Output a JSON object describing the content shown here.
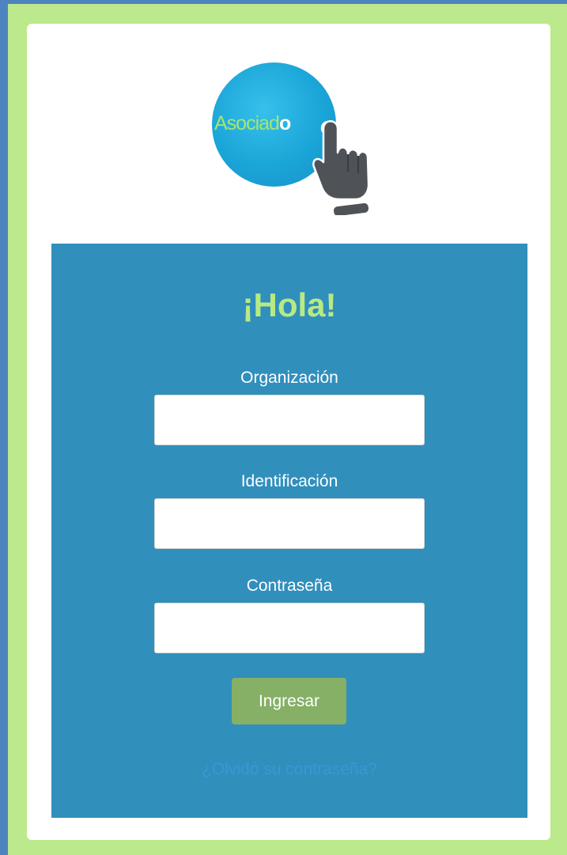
{
  "logo": {
    "text_main": "Asociad",
    "text_o": "o"
  },
  "login": {
    "greeting": "¡Hola!",
    "fields": [
      {
        "label": "Organización",
        "value": ""
      },
      {
        "label": "Identificación",
        "value": ""
      },
      {
        "label": "Contraseña",
        "value": ""
      }
    ],
    "submit_label": "Ingresar",
    "forgot_password": "¿Olvidó su contraseña?"
  },
  "colors": {
    "outer_background": "#bce98c",
    "left_strip": "#4d84bf",
    "card": "#ffffff",
    "panel": "#318fbc",
    "greeting": "#b8ea82",
    "button": "#85b065",
    "link": "#3a96d8"
  }
}
